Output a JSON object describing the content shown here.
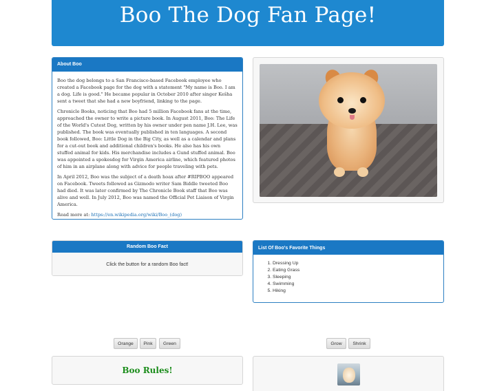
{
  "header": {
    "title": "Boo The Dog Fan Page!"
  },
  "about": {
    "heading": "About Boo",
    "paragraphs": [
      "Boo the dog belongs to a San Francisco-based Facebook employee who created a Facebook page for the dog with a statement \"My name is Boo. I am a dog. Life is good.\" He became popular in October 2010 after singer Keŝha sent a tweet that she had a new boyfriend, linking to the page.",
      "Chronicle Books, noticing that Boo had 5 million Facebook fans at the time, approached the owner to write a picture book. In August 2011, Boo: The Life of the World's Cutest Dog, written by his owner under pen name J.H. Lee, was published. The book was eventually published in ten languages. A second book followed, Boo: Little Dog in the Big City, as well as a calendar and plans for a cut-out book and additional children's books. He also has his own stuffed animal for kids. His merchandise includes a Gund stuffed animal. Boo was appointed a spokesdog for Virgin America airline, which featured photos of him in an airplane along with advice for people traveling with pets.",
      "In April 2012, Boo was the subject of a death hoax after #RIPBOO appeared on Facebook. Tweets followed as Gizmodo writer Sam Biddle tweeted Boo had died. It was later confirmed by The Chronicle Book staff that Boo was alive and well. In July 2012, Boo was named the Official Pet Liaison of Virgin America."
    ],
    "read_more_label": "Read more at:",
    "read_more_link": "https://en.wikipedia.org/wiki/Boo_(dog)"
  },
  "fact": {
    "heading": "Random Boo Fact",
    "text": "Click the button for a random Boo fact!"
  },
  "things": {
    "heading": "List Of Boo's Favorite Things",
    "items": [
      "Dressing Up",
      "Eating Grass",
      "Sleeping",
      "Swimming",
      "Hiking"
    ]
  },
  "color_buttons": [
    "Orange",
    "Pink",
    "Green"
  ],
  "size_buttons": [
    "Grow",
    "Shrink"
  ],
  "rules": {
    "text": "Boo Rules!",
    "color": "#1a8c1a"
  },
  "colors": {
    "header": "#1e88d0",
    "panel_head": "#1a78c4",
    "link": "#1a6fb5"
  }
}
